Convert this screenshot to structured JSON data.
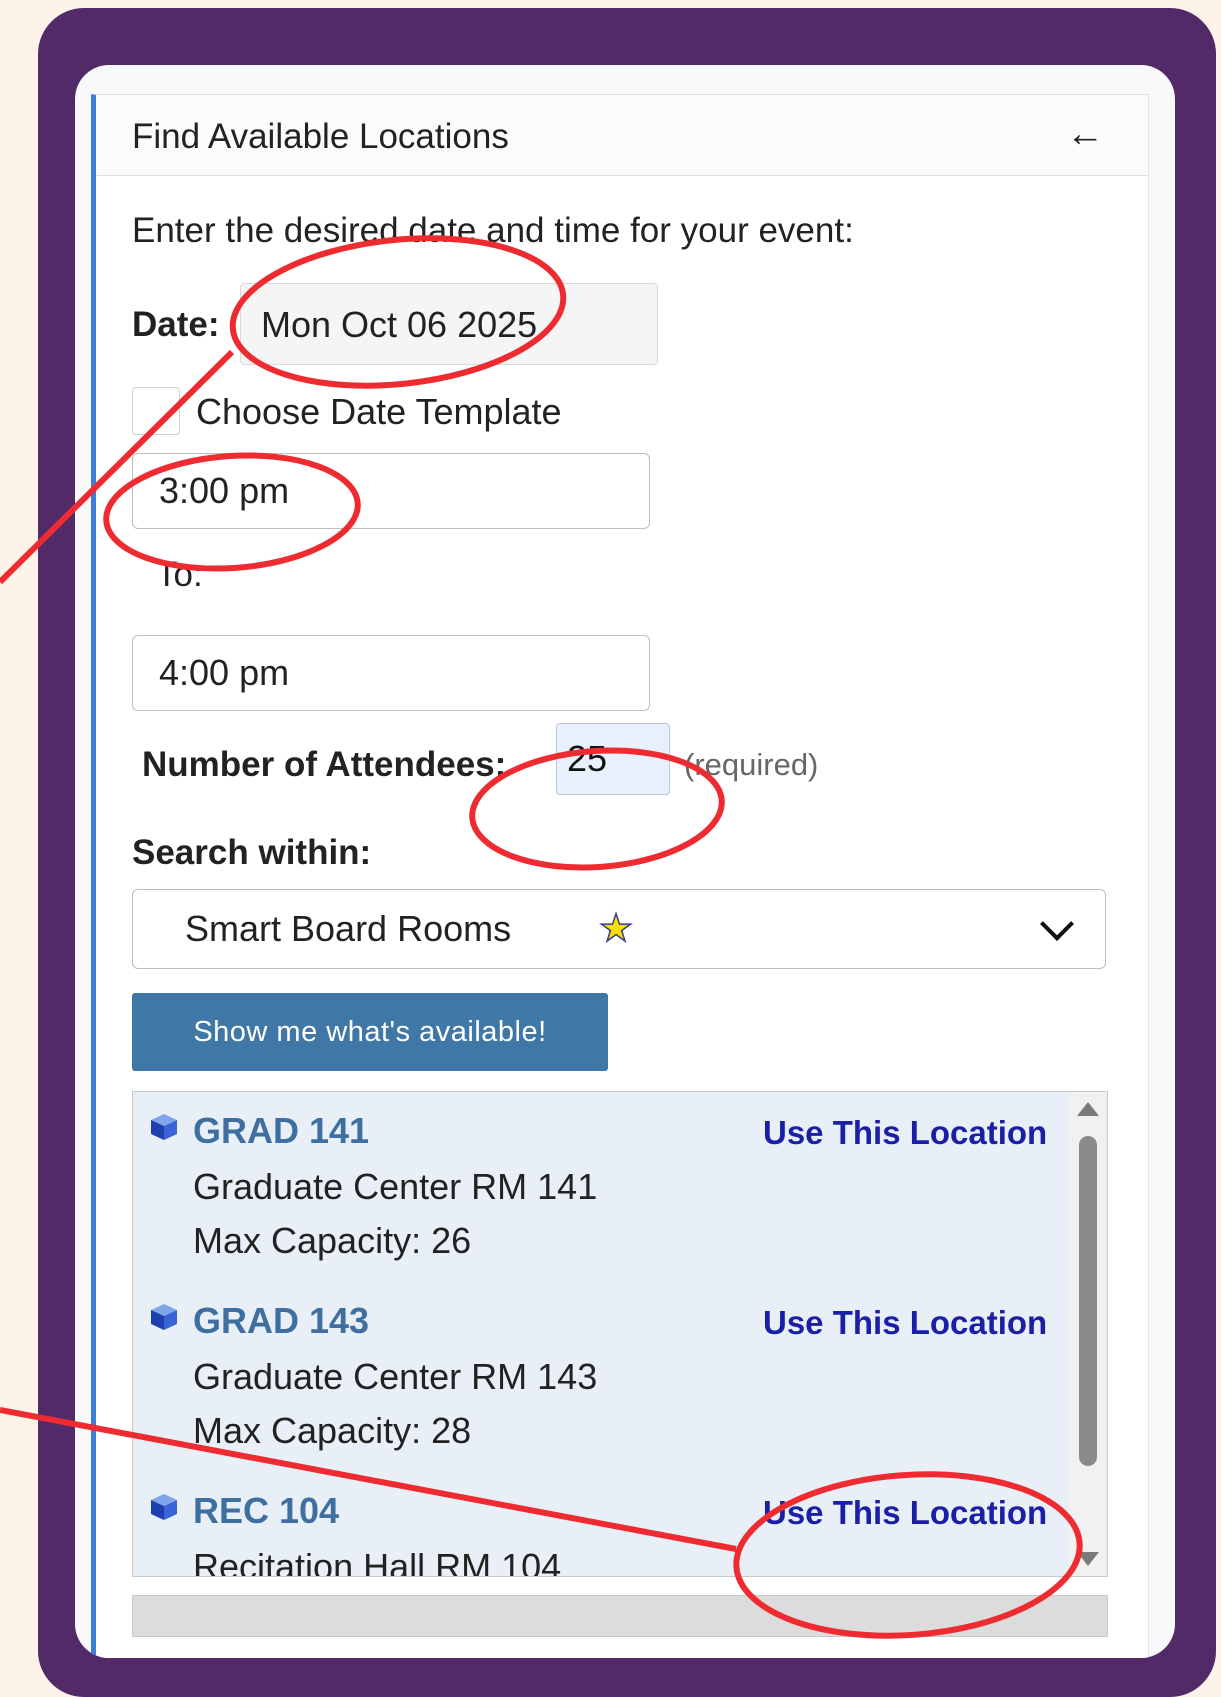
{
  "panel": {
    "title": "Find Available Locations",
    "back_icon": "arrow-left-icon",
    "prompt": "Enter the desired date and time for your event:"
  },
  "form": {
    "date_label": "Date:",
    "date_value": "Mon Oct 06 2025",
    "template_label": "Choose Date Template",
    "template_checked": false,
    "start_time": "3:00 pm",
    "to_label": "To:",
    "end_time": "4:00 pm",
    "attendees_label": "Number of Attendees:",
    "attendees_value": "25",
    "attendees_hint": "(required)",
    "search_label": "Search within:",
    "search_value": "Smart Board Rooms",
    "search_icon": "star-icon",
    "submit_label": "Show me what's available!"
  },
  "results": [
    {
      "code": "GRAD 141",
      "name": "Graduate Center RM 141",
      "capacity": "Max Capacity: 26",
      "action": "Use This Location"
    },
    {
      "code": "GRAD 143",
      "name": "Graduate Center RM 143",
      "capacity": "Max Capacity: 28",
      "action": "Use This Location"
    },
    {
      "code": "REC 104",
      "name": "Recitation Hall RM 104",
      "capacity": "",
      "action": "Use This Location"
    }
  ],
  "colors": {
    "frame": "#522a68",
    "accent": "#3c7fd8",
    "button": "#3f77a6",
    "link": "#1a1fa5",
    "annotation": "#ee2b30"
  }
}
